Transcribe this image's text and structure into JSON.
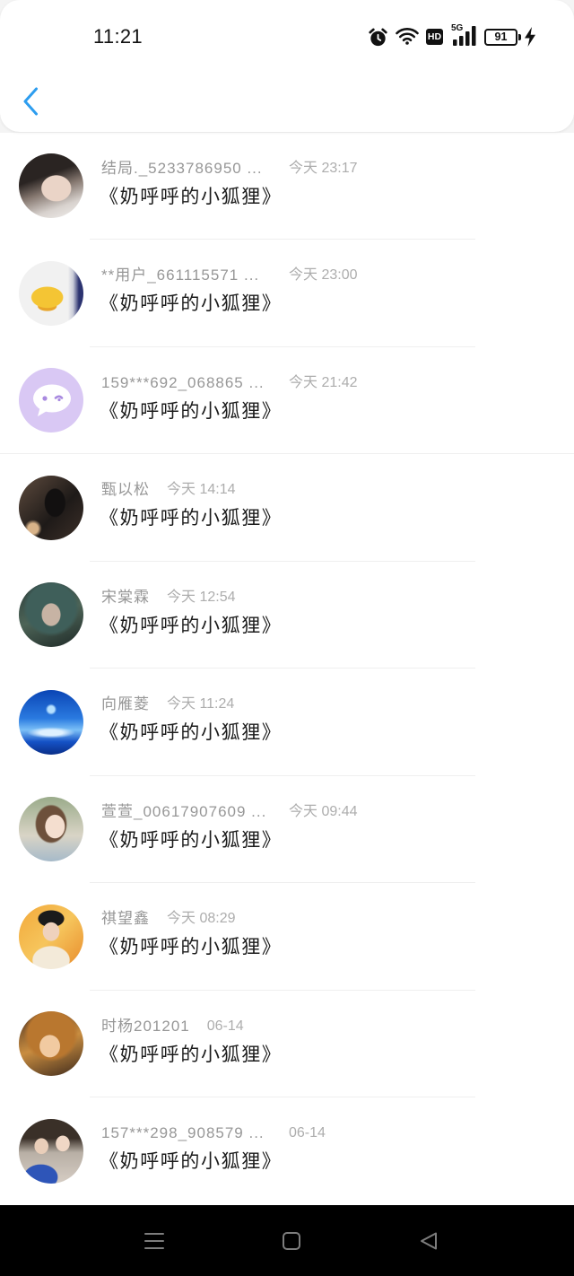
{
  "status_bar": {
    "time": "11:21",
    "network_badge": "HD",
    "signal_label": "5G",
    "battery_level": "91",
    "icons": [
      "alarm-icon",
      "wifi-icon",
      "hd-icon",
      "signal-icon",
      "battery-icon",
      "charging-icon"
    ]
  },
  "header": {
    "back_icon": "chevron-left-icon"
  },
  "colors": {
    "accent": "#2d9def",
    "name_text": "#979797",
    "time_text": "#adadad",
    "message_text": "#1b1b1b",
    "nav_bar": "#000000"
  },
  "messages": [
    {
      "name": "结局._5233786950 ...",
      "time": "今天 23:17",
      "text": "《奶呼呼的小狐狸》"
    },
    {
      "name": "**用户_661115571 ...",
      "time": "今天 23:00",
      "text": "《奶呼呼的小狐狸》"
    },
    {
      "name": "159***692_068865 ...",
      "time": "今天 21:42",
      "text": "《奶呼呼的小狐狸》"
    },
    {
      "name": "甄以松",
      "time": "今天 14:14",
      "text": "《奶呼呼的小狐狸》"
    },
    {
      "name": "宋棠霖",
      "time": "今天 12:54",
      "text": "《奶呼呼的小狐狸》"
    },
    {
      "name": "向雁菱",
      "time": "今天 11:24",
      "text": "《奶呼呼的小狐狸》"
    },
    {
      "name": "萱萱_00617907609 ...",
      "time": "今天 09:44",
      "text": "《奶呼呼的小狐狸》"
    },
    {
      "name": "祺望鑫",
      "time": "今天 08:29",
      "text": "《奶呼呼的小狐狸》"
    },
    {
      "name": "时杨201201",
      "time": "06-14",
      "text": "《奶呼呼的小狐狸》"
    },
    {
      "name": "157***298_908579 ...",
      "time": "06-14",
      "text": "《奶呼呼的小狐狸》"
    }
  ],
  "nav_bar": {
    "icons": [
      "menu-icon",
      "square-icon",
      "back-triangle-icon"
    ]
  }
}
